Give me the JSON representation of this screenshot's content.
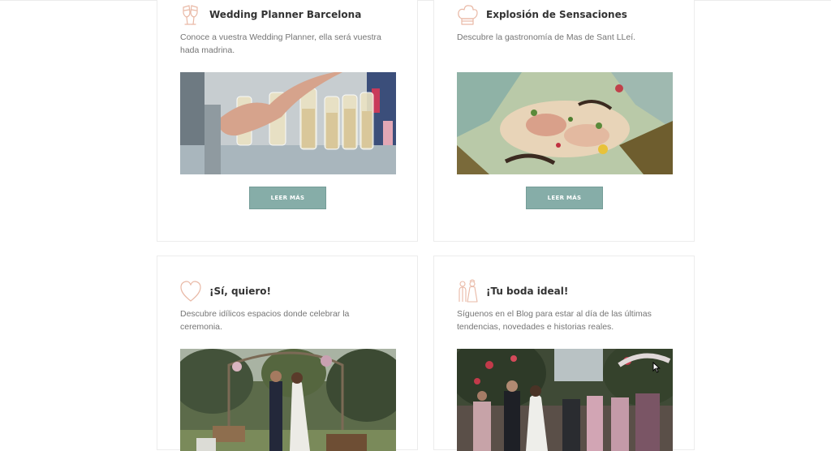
{
  "cards": [
    {
      "title": "Wedding Planner Barcelona",
      "description": "Conoce a vuestra Wedding Planner, ella será vuestra hada madrina.",
      "icon": "champagne-glasses-icon",
      "button_label": "LEER MÁS"
    },
    {
      "title": "Explosión de Sensaciones",
      "description": "Descubre la gastronomía de Mas de Sant LLeí.",
      "icon": "chef-hat-icon",
      "button_label": "LEER MÁS"
    },
    {
      "title": "¡Sí, quiero!",
      "description": "Descubre idílicos espacios donde celebrar la ceremonia.",
      "icon": "heart-icon"
    },
    {
      "title": "¡Tu boda ideal!",
      "description": "Síguenos en el Blog para estar al día de las últimas tendencias, novedades e historias reales.",
      "icon": "wedding-couple-icon"
    }
  ],
  "colors": {
    "accent_icon": "#e9b9a6",
    "button_bg": "#86ada8",
    "title_text": "#333333",
    "body_text": "#757575",
    "card_border": "#ececec"
  }
}
